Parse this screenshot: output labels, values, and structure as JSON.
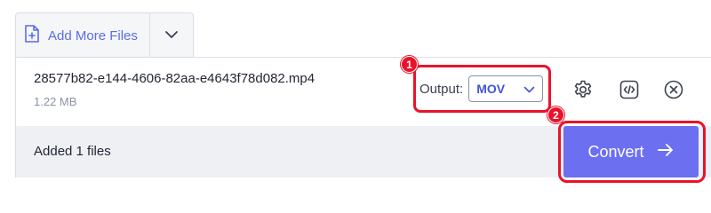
{
  "toolbar": {
    "add_more_label": "Add More Files",
    "add_icon": "file-plus-icon",
    "dropdown_icon": "chevron-down-icon"
  },
  "file": {
    "name": "28577b82-e144-4606-82aa-e4643f78d082.mp4",
    "size": "1.22 MB"
  },
  "output": {
    "label": "Output:",
    "selected": "MOV",
    "dropdown_icon": "chevron-down-icon"
  },
  "row_actions": {
    "settings_icon": "gear-icon",
    "embed_icon": "code-icon",
    "remove_icon": "close-circle-icon"
  },
  "footer": {
    "status": "Added 1 files",
    "convert_label": "Convert",
    "convert_icon": "arrow-right-icon"
  },
  "annotations": {
    "badge_1": "1",
    "badge_2": "2"
  },
  "colors": {
    "accent": "#6b6ff0",
    "link": "#5b6ce8",
    "highlight": "#e8132b"
  }
}
